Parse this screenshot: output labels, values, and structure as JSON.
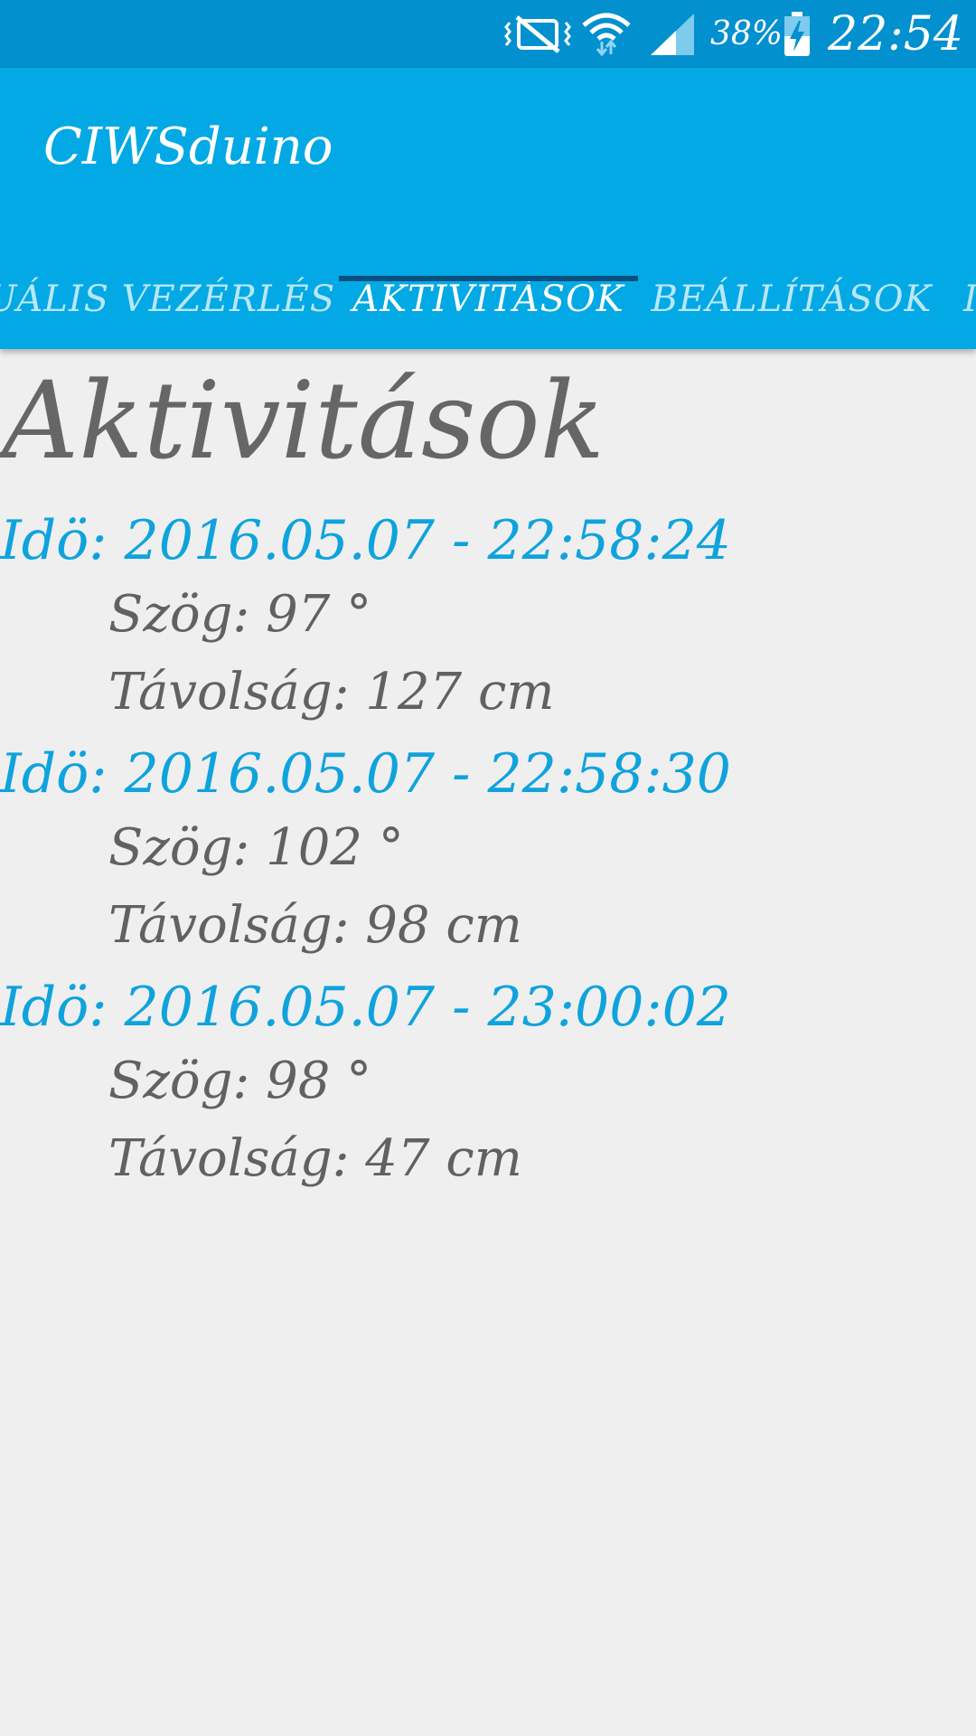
{
  "status_bar": {
    "icons": [
      "vibrate-icon",
      "wifi-icon",
      "signal-icon",
      "battery-charging-icon"
    ],
    "battery_percent": "38%",
    "time": "22:54"
  },
  "app_bar": {
    "title": "CIWSduino",
    "colors": {
      "status_bar": "#0290cf",
      "app_bar": "#03a9e4",
      "indicator": "#0a4f80"
    }
  },
  "tabs": [
    {
      "label": "NUÁLIS VEZÉRLÉS",
      "selected": false
    },
    {
      "label": "AKTIVITÁSOK",
      "selected": true
    },
    {
      "label": "BEÁLLÍTÁSOK",
      "selected": false
    },
    {
      "label": "I",
      "selected": false
    }
  ],
  "main": {
    "heading": "Aktivitások",
    "entries": [
      {
        "time": "Idö: 2016.05.07 - 22:58:24",
        "angle": "Szög: 97 °",
        "distance": "Távolság: 127 cm"
      },
      {
        "time": "Idö: 2016.05.07 - 22:58:30",
        "angle": "Szög: 102 °",
        "distance": "Távolság: 98 cm"
      },
      {
        "time": "Idö: 2016.05.07 - 23:00:02",
        "angle": "Szög: 98 °",
        "distance": "Távolság: 47 cm"
      }
    ]
  }
}
